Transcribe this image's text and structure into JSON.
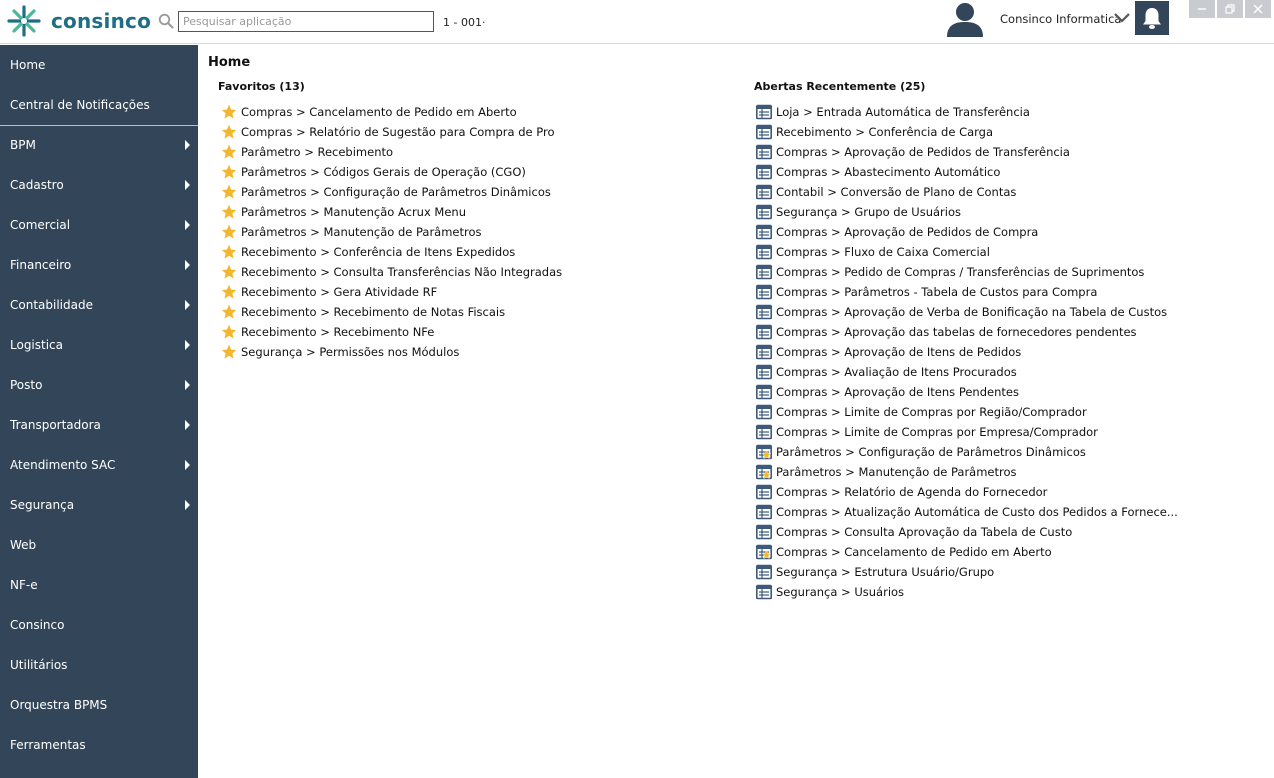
{
  "header": {
    "logo_text": "consinco",
    "search_placeholder": "Pesquisar aplicação",
    "company_code": "1 - 001·",
    "user_name": "Consinco Informatica"
  },
  "sidebar": {
    "items": [
      {
        "label": "Home",
        "has_submenu": false
      },
      {
        "label": "Central de Notificações",
        "has_submenu": false
      },
      {
        "label": "BPM",
        "has_submenu": true
      },
      {
        "label": "Cadastro",
        "has_submenu": true
      },
      {
        "label": "Comercial",
        "has_submenu": true
      },
      {
        "label": "Financeiro",
        "has_submenu": true
      },
      {
        "label": "Contabilidade",
        "has_submenu": true
      },
      {
        "label": "Logistica",
        "has_submenu": true
      },
      {
        "label": "Posto",
        "has_submenu": true
      },
      {
        "label": "Transportadora",
        "has_submenu": true
      },
      {
        "label": "Atendimento SAC",
        "has_submenu": true
      },
      {
        "label": "Segurança",
        "has_submenu": true
      },
      {
        "label": "Web",
        "has_submenu": false
      },
      {
        "label": "NF-e",
        "has_submenu": false
      },
      {
        "label": "Consinco",
        "has_submenu": false
      },
      {
        "label": "Utilitários",
        "has_submenu": false
      },
      {
        "label": "Orquestra BPMS",
        "has_submenu": false
      },
      {
        "label": "Ferramentas",
        "has_submenu": false
      }
    ]
  },
  "main": {
    "title": "Home",
    "favorites_title": "Favoritos (13)",
    "favorites": [
      "Compras > Cancelamento de Pedido em Aberto",
      "Compras > Relatório de Sugestão para Compra de Pro",
      "Parâmetro > Recebimento",
      "Parâmetros > Códigos Gerais de Operação (CGO)",
      "Parâmetros > Configuração de Parâmetros Dinâmicos",
      "Parâmetros > Manutenção Acrux Menu",
      "Parâmetros > Manutenção de Parâmetros",
      "Recebimento > Conferência de Itens Expedidos",
      "Recebimento > Consulta Transferências Não Integradas",
      "Recebimento > Gera Atividade RF",
      "Recebimento > Recebimento de Notas Fiscais",
      "Recebimento > Recebimento NFe",
      "Segurança > Permissões nos Módulos"
    ],
    "recent_title": "Abertas Recentemente (25)",
    "recent": [
      {
        "label": "Loja > Entrada Automática de Transferência",
        "starred": false
      },
      {
        "label": "Recebimento > Conferência de Carga",
        "starred": false
      },
      {
        "label": "Compras > Aprovação de Pedidos de Transferência",
        "starred": false
      },
      {
        "label": "Compras > Abastecimento Automático",
        "starred": false
      },
      {
        "label": "Contabil > Conversão de Plano de Contas",
        "starred": false
      },
      {
        "label": "Segurança > Grupo de Usuários",
        "starred": false
      },
      {
        "label": "Compras > Aprovação de Pedidos de Compra",
        "starred": false
      },
      {
        "label": "Compras > Fluxo de Caixa Comercial",
        "starred": false
      },
      {
        "label": "Compras > Pedido de Compras / Transferências de Suprimentos",
        "starred": false
      },
      {
        "label": "Compras > Parâmetros - Tabela de Custos para Compra",
        "starred": false
      },
      {
        "label": "Compras > Aprovação de Verba de Bonificação na Tabela de Custos",
        "starred": false
      },
      {
        "label": "Compras > Aprovação das tabelas de fornecedores pendentes",
        "starred": false
      },
      {
        "label": "Compras > Aprovação de Itens de Pedidos",
        "starred": false
      },
      {
        "label": "Compras > Avaliação de Itens Procurados",
        "starred": false
      },
      {
        "label": "Compras > Aprovação de Itens Pendentes",
        "starred": false
      },
      {
        "label": "Compras > Limite de Compras por Região/Comprador",
        "starred": false
      },
      {
        "label": "Compras > Limite de Compras por Empresa/Comprador",
        "starred": false
      },
      {
        "label": "Parâmetros > Configuração de Parâmetros Dinâmicos",
        "starred": true
      },
      {
        "label": "Parâmetros > Manutenção de Parâmetros",
        "starred": true
      },
      {
        "label": "Compras > Relatório de Agenda do Fornecedor",
        "starred": false
      },
      {
        "label": "Compras > Atualização Automática de Custo dos Pedidos a Fornece...",
        "starred": false
      },
      {
        "label": "Compras > Consulta Aprovação da Tabela de Custo",
        "starred": false
      },
      {
        "label": "Compras > Cancelamento de Pedido em Aberto",
        "starred": true
      },
      {
        "label": "Segurança > Estrutura Usuário/Grupo",
        "starred": false
      },
      {
        "label": "Segurança > Usuários",
        "starred": false
      }
    ]
  },
  "colors": {
    "sidebar_bg": "#334659",
    "logo_teal": "#1f6e84",
    "logo_green": "#4cb89a",
    "star": "#f3b62c",
    "window_icon": "#3d5a7a"
  },
  "icons": {
    "search": "search-icon",
    "user": "user-avatar-icon",
    "chevron": "chevron-down-icon",
    "bell": "bell-icon",
    "star": "star-icon",
    "window": "window-icon"
  }
}
